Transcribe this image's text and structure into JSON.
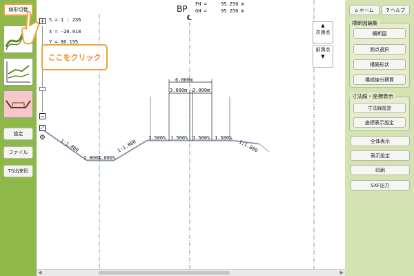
{
  "left_panel": {
    "mode_button": "線形切替",
    "settings_button": "設定",
    "file_button": "ファイル",
    "ts_button": "TS出来形"
  },
  "callout": {
    "text": "ここをクリック"
  },
  "canvas": {
    "scale": "S = 1 : 236",
    "x": "X =  -20.918",
    "y": "Y =   80.195",
    "station": "BP",
    "fh_label": "FH =",
    "fh_value": "95.250 m",
    "gh_label": "GH =",
    "gh_value": "95.250 m",
    "centerline_symbol": "℄",
    "next_point_label": "次測点",
    "prev_point_label": "前測点",
    "dim_total": "6.000m",
    "dim_left": "3.000m",
    "dim_right": "3.000m",
    "slope_labels": [
      "1:1.800",
      "2.000%",
      "2.000%",
      "1:1.800",
      "1.500%",
      "1.500%",
      "1.500%",
      "1.500%",
      "1:1.800"
    ]
  },
  "right_panel": {
    "home_button": "ホーム",
    "help_button": "ヘルプ",
    "section_edit": {
      "title": "横断図編集",
      "buttons": [
        "横断図",
        "測点選択",
        "構築形状",
        "構成線分積算"
      ]
    },
    "dimension_display": {
      "title": "寸法線・座標表示",
      "buttons": [
        "寸法線設定",
        "座標表示設定"
      ]
    },
    "bottom_buttons": [
      "全体表示",
      "表示設定",
      "印刷",
      "SXF出力"
    ]
  },
  "colors": {
    "left_panel": "#8fb84a",
    "right_panel": "#d4e3b1",
    "highlight": "#f0a13a",
    "centerline": "#5b86b8",
    "ground_line": "#8aa7cf"
  }
}
